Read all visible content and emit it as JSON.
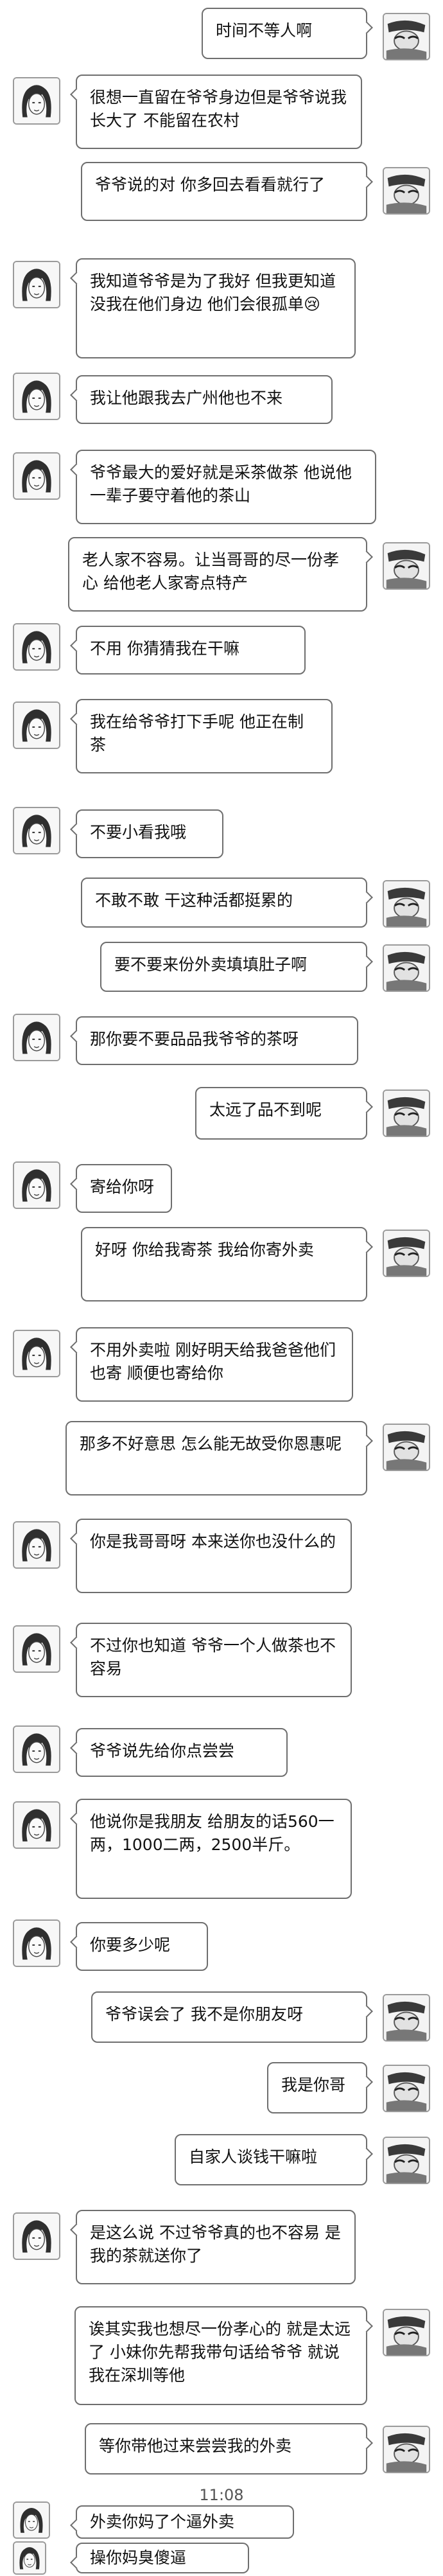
{
  "messages": [
    {
      "side": "right",
      "avatar": "sketch-avatar-right",
      "text": "时间不等人啊"
    },
    {
      "side": "left",
      "avatar": "sketch-avatar-left",
      "text": "很想一直留在爷爷身边但是爷爷说我长大了 不能留在农村"
    },
    {
      "side": "right",
      "avatar": "sketch-avatar-right",
      "text": "爷爷说的对 你多回去看看就行了"
    },
    {
      "side": "left",
      "avatar": "sketch-avatar-left",
      "text": "我知道爷爷是为了我好 但我更知道 没我在他们身边 他们会很孤单😢"
    },
    {
      "side": "left",
      "avatar": "sketch-avatar-left",
      "text": "我让他跟我去广州他也不来"
    },
    {
      "side": "left",
      "avatar": "sketch-avatar-left",
      "text": "爷爷最大的爱好就是采茶做茶 他说他一辈子要守着他的茶山"
    },
    {
      "side": "right",
      "avatar": "sketch-avatar-right",
      "text": "老人家不容易。让当哥哥的尽一份孝心 给他老人家寄点特产"
    },
    {
      "side": "left",
      "avatar": "sketch-avatar-left",
      "text": "不用 你猜猜我在干嘛"
    },
    {
      "side": "left",
      "avatar": "sketch-avatar-left",
      "text": "我在给爷爷打下手呢 他正在制茶"
    },
    {
      "side": "left",
      "avatar": "sketch-avatar-left",
      "text": "不要小看我哦"
    },
    {
      "side": "right",
      "avatar": "sketch-avatar-right",
      "text": "不敢不敢  干这种活都挺累的"
    },
    {
      "side": "right",
      "avatar": "sketch-avatar-right",
      "text": "要不要来份外卖填填肚子啊"
    },
    {
      "side": "left",
      "avatar": "sketch-avatar-left",
      "text": "那你要不要品品我爷爷的茶呀"
    },
    {
      "side": "right",
      "avatar": "sketch-avatar-right",
      "text": "太远了品不到呢"
    },
    {
      "side": "left",
      "avatar": "sketch-avatar-left",
      "text": "寄给你呀"
    },
    {
      "side": "right",
      "avatar": "sketch-avatar-right",
      "text": "好呀 你给我寄茶 我给你寄外卖"
    },
    {
      "side": "left",
      "avatar": "sketch-avatar-left",
      "text": "不用外卖啦 刚好明天给我爸爸他们也寄 顺便也寄给你"
    },
    {
      "side": "right",
      "avatar": "sketch-avatar-right",
      "text": "那多不好意思 怎么能无故受你恩惠呢"
    },
    {
      "side": "left",
      "avatar": "sketch-avatar-left",
      "text": "你是我哥哥呀 本来送你也没什么的"
    },
    {
      "side": "left",
      "avatar": "sketch-avatar-left",
      "text": "不过你也知道 爷爷一个人做茶也不容易"
    },
    {
      "side": "left",
      "avatar": "sketch-avatar-left",
      "text": "爷爷说先给你点尝尝"
    },
    {
      "side": "left",
      "avatar": "sketch-avatar-left",
      "text": "他说你是我朋友 给朋友的话560一两，1000二两，2500半斤。"
    },
    {
      "side": "left",
      "avatar": "sketch-avatar-left",
      "text": "你要多少呢"
    },
    {
      "side": "right",
      "avatar": "sketch-avatar-right",
      "text": "爷爷误会了 我不是你朋友呀"
    },
    {
      "side": "right",
      "avatar": "sketch-avatar-right",
      "text": "我是你哥"
    },
    {
      "side": "right",
      "avatar": "sketch-avatar-right",
      "text": "自家人谈钱干嘛啦"
    },
    {
      "side": "left",
      "avatar": "sketch-avatar-left",
      "text": "是这么说 不过爷爷真的也不容易 是我的茶就送你了"
    },
    {
      "side": "right",
      "avatar": "sketch-avatar-right",
      "text": "诶其实我也想尽一份孝心的 就是太远了 小妹你先帮我带句话给爷爷 就说我在深圳等他"
    },
    {
      "side": "right",
      "avatar": "sketch-avatar-right",
      "text": "等你带他过来尝尝我的外卖"
    },
    {
      "type": "time",
      "text": "11:08"
    },
    {
      "side": "left",
      "avatar": "sketch-avatar-left",
      "text": "外卖你妈了个逼外卖"
    },
    {
      "side": "left",
      "avatar": "sketch-avatar-left",
      "text": "操你妈臭傻逼"
    }
  ]
}
